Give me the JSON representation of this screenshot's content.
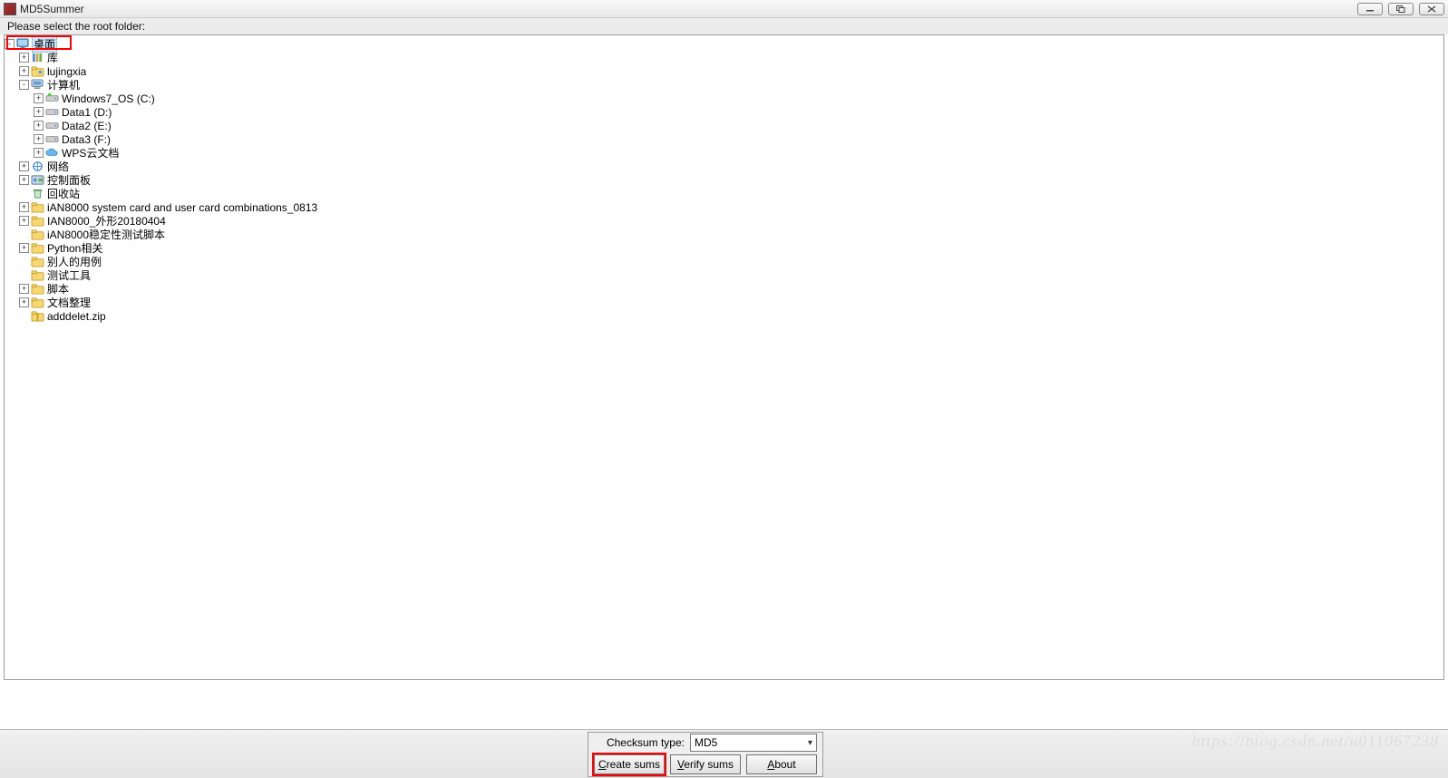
{
  "window": {
    "title": "MD5Summer"
  },
  "prompt": "Please select the root folder:",
  "tree": {
    "root": {
      "label": "桌面",
      "icon": "desktop",
      "expanded": true,
      "selected": true,
      "children": [
        {
          "label": "库",
          "icon": "library",
          "toggle": "+",
          "children": []
        },
        {
          "label": "lujingxia",
          "icon": "user-folder",
          "toggle": "+",
          "children": []
        },
        {
          "label": "计算机",
          "icon": "computer",
          "toggle": "-",
          "children": [
            {
              "label": "Windows7_OS (C:)",
              "icon": "drive-os",
              "toggle": "+",
              "children": []
            },
            {
              "label": "Data1 (D:)",
              "icon": "drive",
              "toggle": "+",
              "children": []
            },
            {
              "label": "Data2 (E:)",
              "icon": "drive",
              "toggle": "+",
              "children": []
            },
            {
              "label": "Data3 (F:)",
              "icon": "drive",
              "toggle": "+",
              "children": []
            },
            {
              "label": "WPS云文档",
              "icon": "cloud",
              "toggle": "+",
              "children": []
            }
          ]
        },
        {
          "label": "网络",
          "icon": "network",
          "toggle": "+",
          "children": []
        },
        {
          "label": "控制面板",
          "icon": "control-panel",
          "toggle": "+",
          "children": []
        },
        {
          "label": "回收站",
          "icon": "recycle-bin",
          "toggle": "",
          "children": []
        },
        {
          "label": "iAN8000 system card and user card combinations_0813",
          "icon": "folder",
          "toggle": "+",
          "children": []
        },
        {
          "label": "IAN8000_外形20180404",
          "icon": "folder",
          "toggle": "+",
          "children": []
        },
        {
          "label": "iAN8000稳定性测试脚本",
          "icon": "folder",
          "toggle": "",
          "children": []
        },
        {
          "label": "Python相关",
          "icon": "folder",
          "toggle": "+",
          "children": []
        },
        {
          "label": "别人的用例",
          "icon": "folder",
          "toggle": "",
          "children": []
        },
        {
          "label": "测试工具",
          "icon": "folder",
          "toggle": "",
          "children": []
        },
        {
          "label": "脚本",
          "icon": "folder",
          "toggle": "+",
          "children": []
        },
        {
          "label": "文档整理",
          "icon": "folder",
          "toggle": "+",
          "children": []
        },
        {
          "label": "adddelet.zip",
          "icon": "zip",
          "toggle": "",
          "children": []
        }
      ]
    }
  },
  "footer": {
    "checksum_label": "Checksum type:",
    "checksum_value": "MD5",
    "create_label": "Create sums",
    "verify_label": "Verify sums",
    "about_label": "About"
  },
  "watermark": "https://blog.csdn.net/u011067238"
}
